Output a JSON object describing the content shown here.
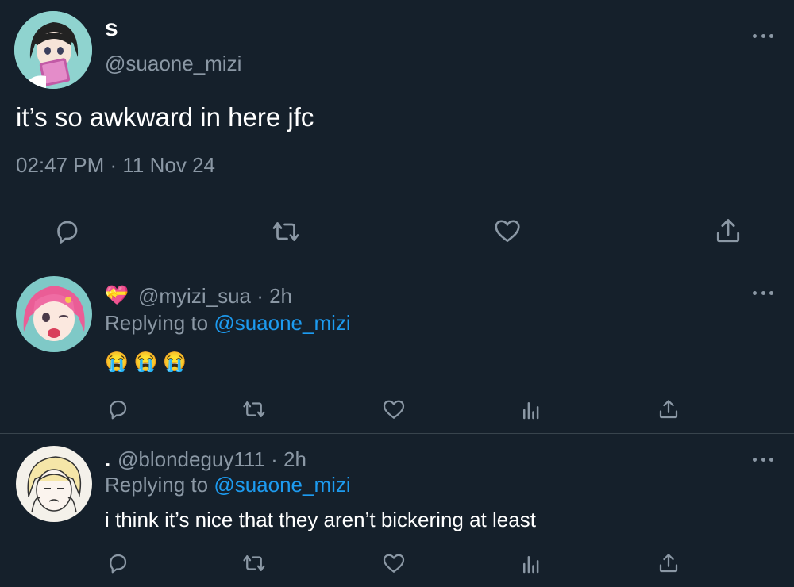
{
  "main_tweet": {
    "display_name": "s",
    "handle": "@suaone_mizi",
    "text": "it’s so awkward in here jfc",
    "timestamp": "02:47 PM · 11 Nov 24",
    "actions": [
      "reply-icon",
      "retweet-icon",
      "like-icon",
      "share-icon"
    ]
  },
  "replies": [
    {
      "name_emoji": "💝",
      "meta": "@myizi_sua · 2h",
      "replying_prefix": "Replying to",
      "replying_handle": "@suaone_mizi",
      "text": "😭 😭 😭"
    },
    {
      "name": ".",
      "meta": "@blondeguy111 · 2h",
      "replying_prefix": "Replying to",
      "replying_handle": "@suaone_mizi",
      "text": "i think it’s nice that they aren’t bickering at least"
    }
  ],
  "colors": {
    "background": "#15202b",
    "muted": "#8b98a5",
    "link": "#1d9bf0",
    "divider": "#38444d"
  }
}
